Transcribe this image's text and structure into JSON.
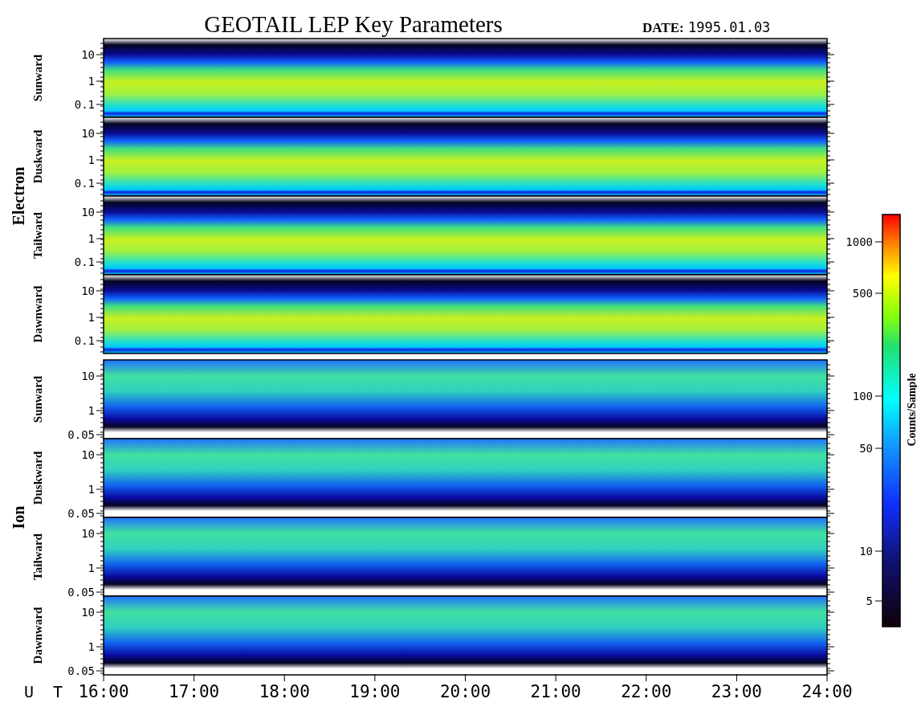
{
  "title": "GEOTAIL LEP Key Parameters",
  "date_label": "DATE:",
  "date": "1995.01.03",
  "groups": [
    {
      "name": "Electron",
      "kind": "electron",
      "channels": [
        {
          "name": "Sunward",
          "yticks": [
            "10",
            "1",
            "0.1"
          ]
        },
        {
          "name": "Duskward",
          "yticks": [
            "10",
            "1",
            "0.1"
          ]
        },
        {
          "name": "Tailward",
          "yticks": [
            "10",
            "1",
            "0.1"
          ]
        },
        {
          "name": "Dawnward",
          "yticks": [
            "10",
            "1",
            "0.1"
          ]
        }
      ]
    },
    {
      "name": "Ion",
      "kind": "ion",
      "channels": [
        {
          "name": "Sunward",
          "yticks": [
            "10",
            "1",
            "0.05"
          ]
        },
        {
          "name": "Duskward",
          "yticks": [
            "10",
            "1",
            "0.05"
          ]
        },
        {
          "name": "Tailward",
          "yticks": [
            "10",
            "1",
            "0.05"
          ]
        },
        {
          "name": "Dawnward",
          "yticks": [
            "10",
            "1",
            "0.05"
          ]
        }
      ]
    }
  ],
  "x_axis": {
    "label": "U T",
    "ticks": [
      "16:00",
      "17:00",
      "18:00",
      "19:00",
      "20:00",
      "21:00",
      "22:00",
      "23:00",
      "24:00"
    ]
  },
  "colorbar": {
    "label": "Counts/Sample",
    "ticks": [
      "1000",
      "500",
      "100",
      "50",
      "10",
      "5"
    ]
  }
}
